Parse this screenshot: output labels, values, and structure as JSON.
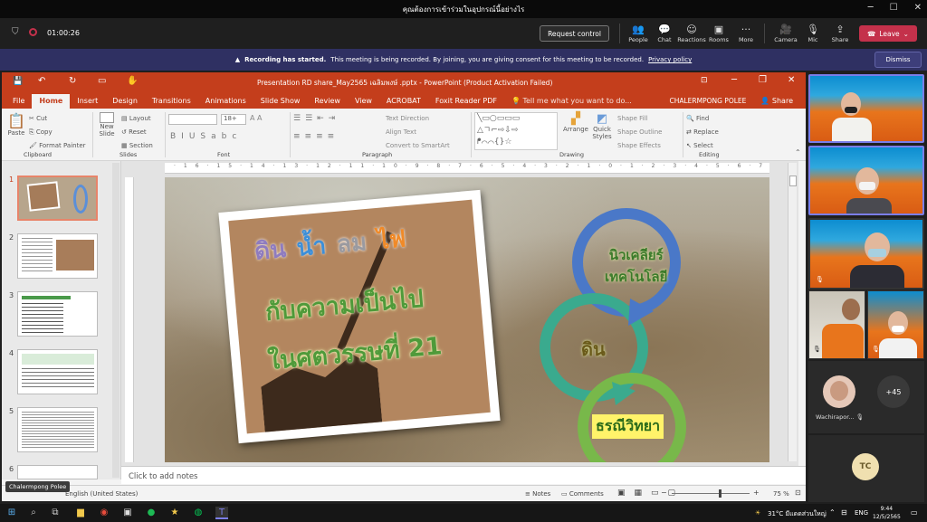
{
  "teams": {
    "window_title": "คุณต้องการเข้าร่วมในอุปกรณ์นี้อย่างไร",
    "timer": "01:00:26",
    "request_control": "Request control",
    "tools": [
      "People",
      "Chat",
      "Reactions",
      "Rooms",
      "More",
      "Camera",
      "Mic",
      "Share"
    ],
    "leave": "Leave",
    "recording_title": "Recording has started.",
    "recording_text": "This meeting is being recorded. By joining, you are giving consent for this meeting to be recorded.",
    "privacy": "Privacy policy",
    "dismiss": "Dismiss"
  },
  "ppt": {
    "title": "Presentation RD share_May2565 เฉลิมพงษ์ .pptx - PowerPoint (Product Activation Failed)",
    "tabs": [
      "File",
      "Home",
      "Insert",
      "Design",
      "Transitions",
      "Animations",
      "Slide Show",
      "Review",
      "View",
      "ACROBAT",
      "Foxit Reader PDF"
    ],
    "tell_me": "Tell me what you want to do...",
    "user": "CHALERMPONG POLEE",
    "share": "Share",
    "ribbon": {
      "paste": "Paste",
      "cut": "Cut",
      "copy": "Copy",
      "format_painter": "Format Painter",
      "new_slide": "New Slide",
      "layout": "Layout",
      "reset": "Reset",
      "section": "Section",
      "font_size": "18+",
      "text_direction": "Text Direction",
      "align_text": "Align Text",
      "convert_smartart": "Convert to SmartArt",
      "arrange": "Arrange",
      "quick_styles": "Quick Styles",
      "shape_fill": "Shape Fill",
      "shape_outline": "Shape Outline",
      "shape_effects": "Shape Effects",
      "find": "Find",
      "replace": "Replace",
      "select": "Select",
      "groups": [
        "Clipboard",
        "Slides",
        "Font",
        "Paragraph",
        "Drawing",
        "Editing"
      ]
    },
    "slide_numbers": [
      "1",
      "2",
      "3",
      "4",
      "5",
      "6"
    ],
    "slide": {
      "title_words": [
        "ดิน",
        "น้ำ",
        "ลม",
        "ไฟ"
      ],
      "line2": "กับความเป็นไป",
      "line3": "ในศตวรรษที่ 21",
      "cycle": [
        "นิวเคลียร์",
        "เทคโนโลยี",
        "ดิน",
        "ธรณีวิทยา"
      ]
    },
    "notes_placeholder": "Click to add notes",
    "status_lang": "English (United States)",
    "presenter_tag": "Chalermpong Polee",
    "notes_btn": "Notes",
    "comments_btn": "Comments",
    "zoom": "75 %"
  },
  "participants": {
    "name_tag": "Wachirapor...",
    "more_count": "+45",
    "initials": "TC"
  },
  "taskbar": {
    "weather": "31°C มีแดดส่วนใหญ่",
    "lang": "ENG",
    "time": "9:44",
    "date": "12/5/2565"
  },
  "colors": {
    "ppt_accent": "#c43e1c",
    "teams_banner": "#2f3062",
    "leave_red": "#c4314b"
  }
}
